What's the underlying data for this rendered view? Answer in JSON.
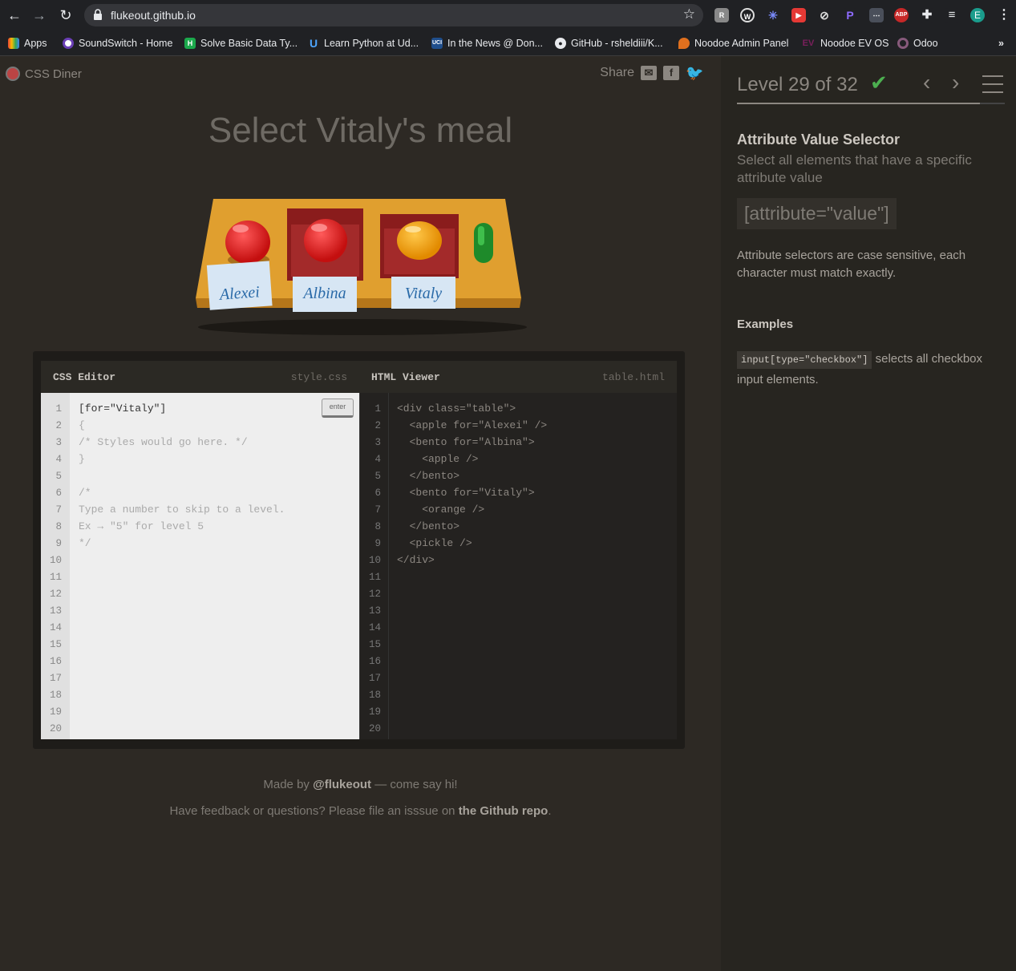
{
  "browser": {
    "url": "flukeout.github.io",
    "bookmarks": [
      {
        "label": "Apps",
        "icon": "apps-grid-icon"
      },
      {
        "label": "SoundSwitch - Home",
        "icon": "soundswitch-icon"
      },
      {
        "label": "Solve Basic Data Ty...",
        "icon": "hackerrank-icon"
      },
      {
        "label": "Learn Python at Ud...",
        "icon": "udemy-icon"
      },
      {
        "label": "In the News @ Don...",
        "icon": "uci-icon"
      },
      {
        "label": "GitHub - rsheldiii/K...",
        "icon": "github-icon"
      },
      {
        "label": "Noodoe Admin Panel",
        "icon": "noodoe-icon"
      },
      {
        "label": "Noodoe EV OS",
        "icon": "ev-icon"
      },
      {
        "label": "Odoo",
        "icon": "odoo-icon"
      }
    ],
    "bookmarks_more": "»",
    "profile_initial": "E",
    "extensions": [
      "R",
      "W",
      "✳",
      "▶",
      "⊘",
      "P",
      "⋯",
      "ABP"
    ]
  },
  "app": {
    "logo": "CSS Diner",
    "share_label": "Share",
    "share_icons": [
      "email-icon",
      "facebook-icon",
      "twitter-icon"
    ],
    "title": "Select Vitaly's meal",
    "plates": {
      "alexei": "Alexei",
      "albina": "Albina",
      "vitaly": "Vitaly"
    },
    "css_pane": {
      "title": "CSS Editor",
      "file": "style.css",
      "input": "[for=\"Vitaly\"]",
      "enter": "enter",
      "lines": [
        "{",
        "/* Styles would go here. */",
        "}",
        "",
        "/*",
        "Type a number to skip to a level.",
        "Ex → \"5\" for level 5",
        "*/"
      ]
    },
    "html_pane": {
      "title": "HTML Viewer",
      "file": "table.html",
      "lines": [
        "<div class=\"table\">",
        "  <apple for=\"Alexei\" />",
        "  <bento for=\"Albina\">",
        "    <apple />",
        "  </bento>",
        "  <bento for=\"Vitaly\">",
        "    <orange />",
        "  </bento>",
        "  <pickle />",
        "</div>"
      ]
    },
    "line_numbers": [
      "1",
      "2",
      "3",
      "4",
      "5",
      "6",
      "7",
      "8",
      "9",
      "10",
      "11",
      "12",
      "13",
      "14",
      "15",
      "16",
      "17",
      "18",
      "19",
      "20"
    ],
    "footer": {
      "made_by_prefix": "Made by",
      "made_by_link": "@flukeout",
      "made_by_suffix": "— come say hi!",
      "feedback_prefix": "Have feedback or questions? Please file an isssue on",
      "feedback_link": "the Github repo",
      "feedback_suffix": "."
    }
  },
  "sidebar": {
    "level_text": "Level 29 of 32",
    "completed_icon": "checkmark-icon",
    "prev": "‹",
    "next": "›",
    "progress": 0.906,
    "selector_name": "Attribute Value Selector",
    "selector_desc": "Select all elements that have a specific attribute value",
    "syntax": "[attribute=\"value\"]",
    "hint": "Attribute selectors are case sensitive, each character must match exactly.",
    "examples_title": "Examples",
    "example_code": "input[type=\"checkbox\"]",
    "example_text": "selects all checkbox input elements."
  },
  "colors": {
    "page_bg": "#2d2924",
    "sidebar_bg": "#272520",
    "check": "#4caf50",
    "table": "#e09f2f"
  }
}
